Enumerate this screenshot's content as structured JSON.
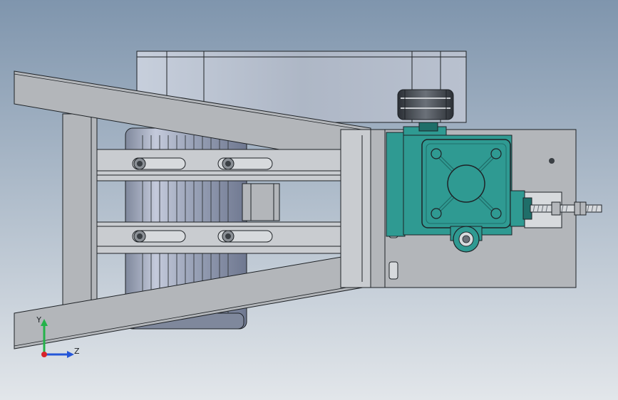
{
  "viewport": {
    "background_top": "#7f95ad",
    "background_bottom": "#e2e6ea"
  },
  "colors": {
    "frame_gray": "#b3b6ba",
    "frame_light": "#c9ccd0",
    "outline": "#1e2226",
    "belt_housing": "#aeb7c6",
    "motor_body": "#aab2c6",
    "motor_dark": "#7f889c",
    "gearbox_teal": "#2f9a92",
    "gearbox_dark": "#1f6e69",
    "steel": "#d7dadd",
    "bolt_dark": "#3a3f44"
  },
  "triad": {
    "y_axis_label": "Y",
    "z_axis_label": "Z",
    "y_color": "#24b24a",
    "z_color": "#2456d8",
    "origin_color": "#d8232a"
  }
}
